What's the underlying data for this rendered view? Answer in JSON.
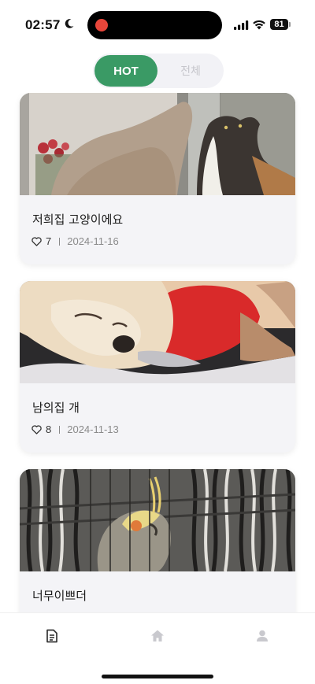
{
  "status_bar": {
    "time": "02:57",
    "battery": "81"
  },
  "toggle": {
    "hot_label": "HOT",
    "all_label": "전체",
    "selected": "HOT",
    "accent_color": "#3a9a65"
  },
  "feed": {
    "posts": [
      {
        "title": "저희집 고양이에요",
        "likes": "7",
        "date": "2024-11-16",
        "image": "two cats by a window"
      },
      {
        "title": "남의집 개",
        "likes": "8",
        "date": "2024-11-13",
        "image": "sleeping chihuahua in red shirt"
      },
      {
        "title": "너무이쁘더",
        "likes": "",
        "date": "",
        "image": "cockatiel in a cage"
      }
    ]
  },
  "tab_bar": {
    "items": [
      {
        "icon": "document-icon",
        "active": true
      },
      {
        "icon": "home-icon",
        "active": false
      },
      {
        "icon": "person-icon",
        "active": false
      }
    ]
  }
}
